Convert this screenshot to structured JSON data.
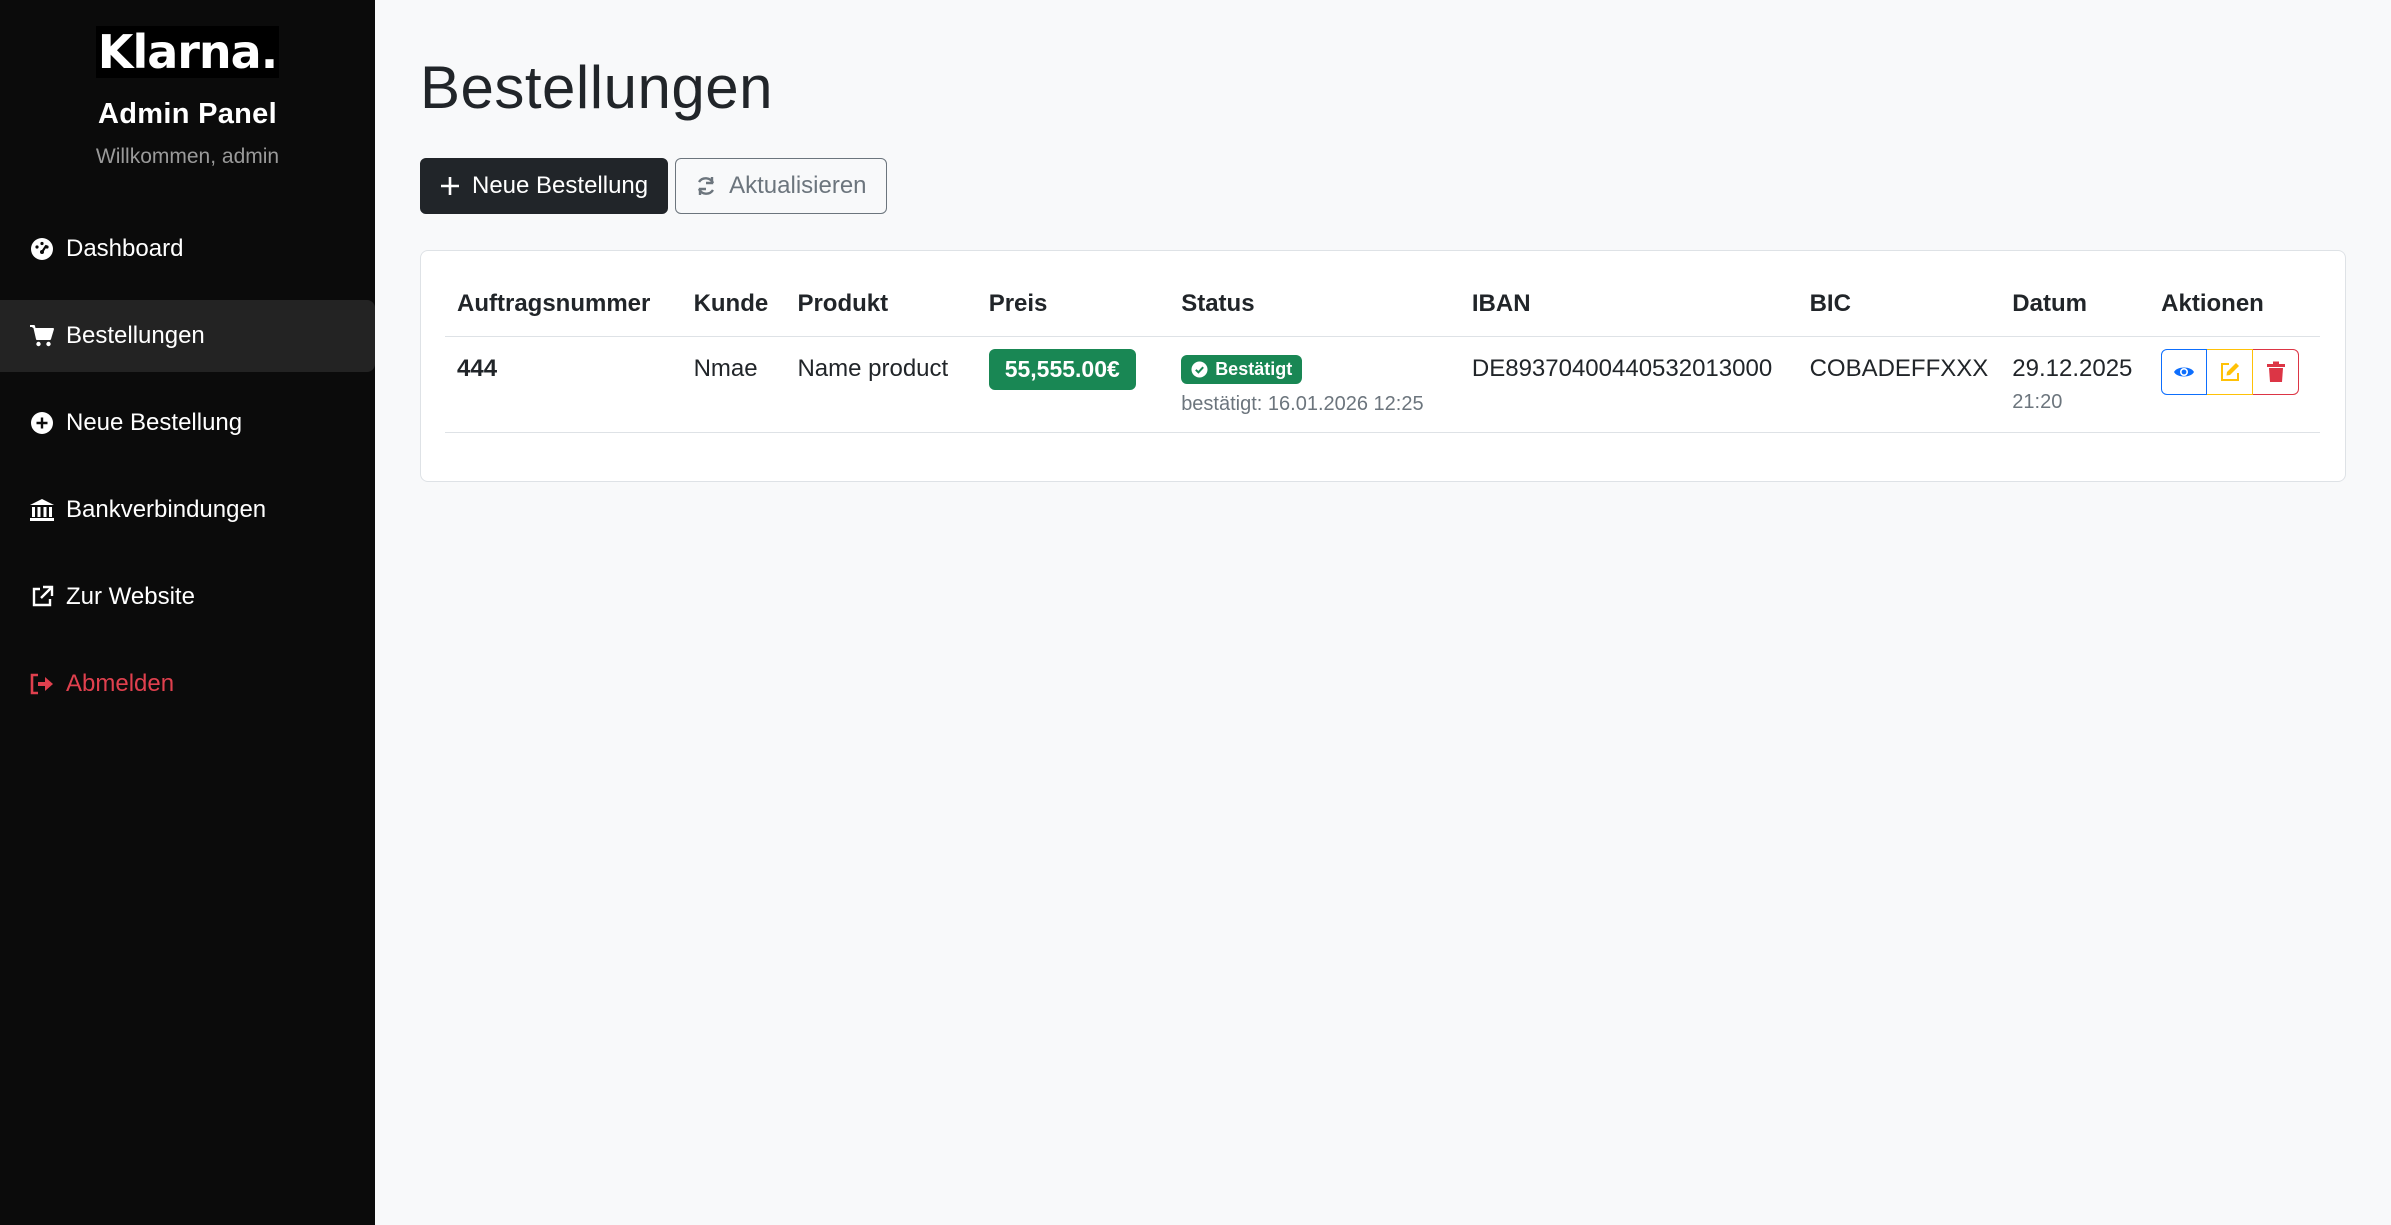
{
  "sidebar": {
    "logo": "Klarna.",
    "title": "Admin Panel",
    "welcome": "Willkommen, admin",
    "items": [
      {
        "label": "Dashboard",
        "icon": "speedometer-icon"
      },
      {
        "label": "Bestellungen",
        "icon": "cart-icon",
        "active": true
      },
      {
        "label": "Neue Bestellung",
        "icon": "plus-circle-icon"
      },
      {
        "label": "Bankverbindungen",
        "icon": "bank-icon"
      },
      {
        "label": "Zur Website",
        "icon": "external-link-icon"
      },
      {
        "label": "Abmelden",
        "icon": "logout-icon"
      }
    ]
  },
  "main": {
    "title": "Bestellungen",
    "toolbar": {
      "new_label": "Neue Bestellung",
      "refresh_label": "Aktualisieren"
    },
    "table": {
      "headers": [
        "Auftragsnummer",
        "Kunde",
        "Produkt",
        "Preis",
        "Status",
        "IBAN",
        "BIC",
        "Datum",
        "Aktionen"
      ],
      "rows": [
        {
          "order_no": "444",
          "customer": "Nmae",
          "product": "Name product",
          "price": "55,555.00€",
          "status": "Bestätigt",
          "status_note": "bestätigt: 16.01.2026 12:25",
          "iban": "DE89370400440532013000",
          "bic": "COBADEFFXXX",
          "date": "29.12.2025",
          "time": "21:20"
        }
      ]
    }
  },
  "colors": {
    "sidebar_bg": "#0b0b0b",
    "success": "#198754",
    "logout": "#e0404e",
    "view": "#0d6efd",
    "edit": "#ffc107",
    "delete": "#dc3545"
  }
}
